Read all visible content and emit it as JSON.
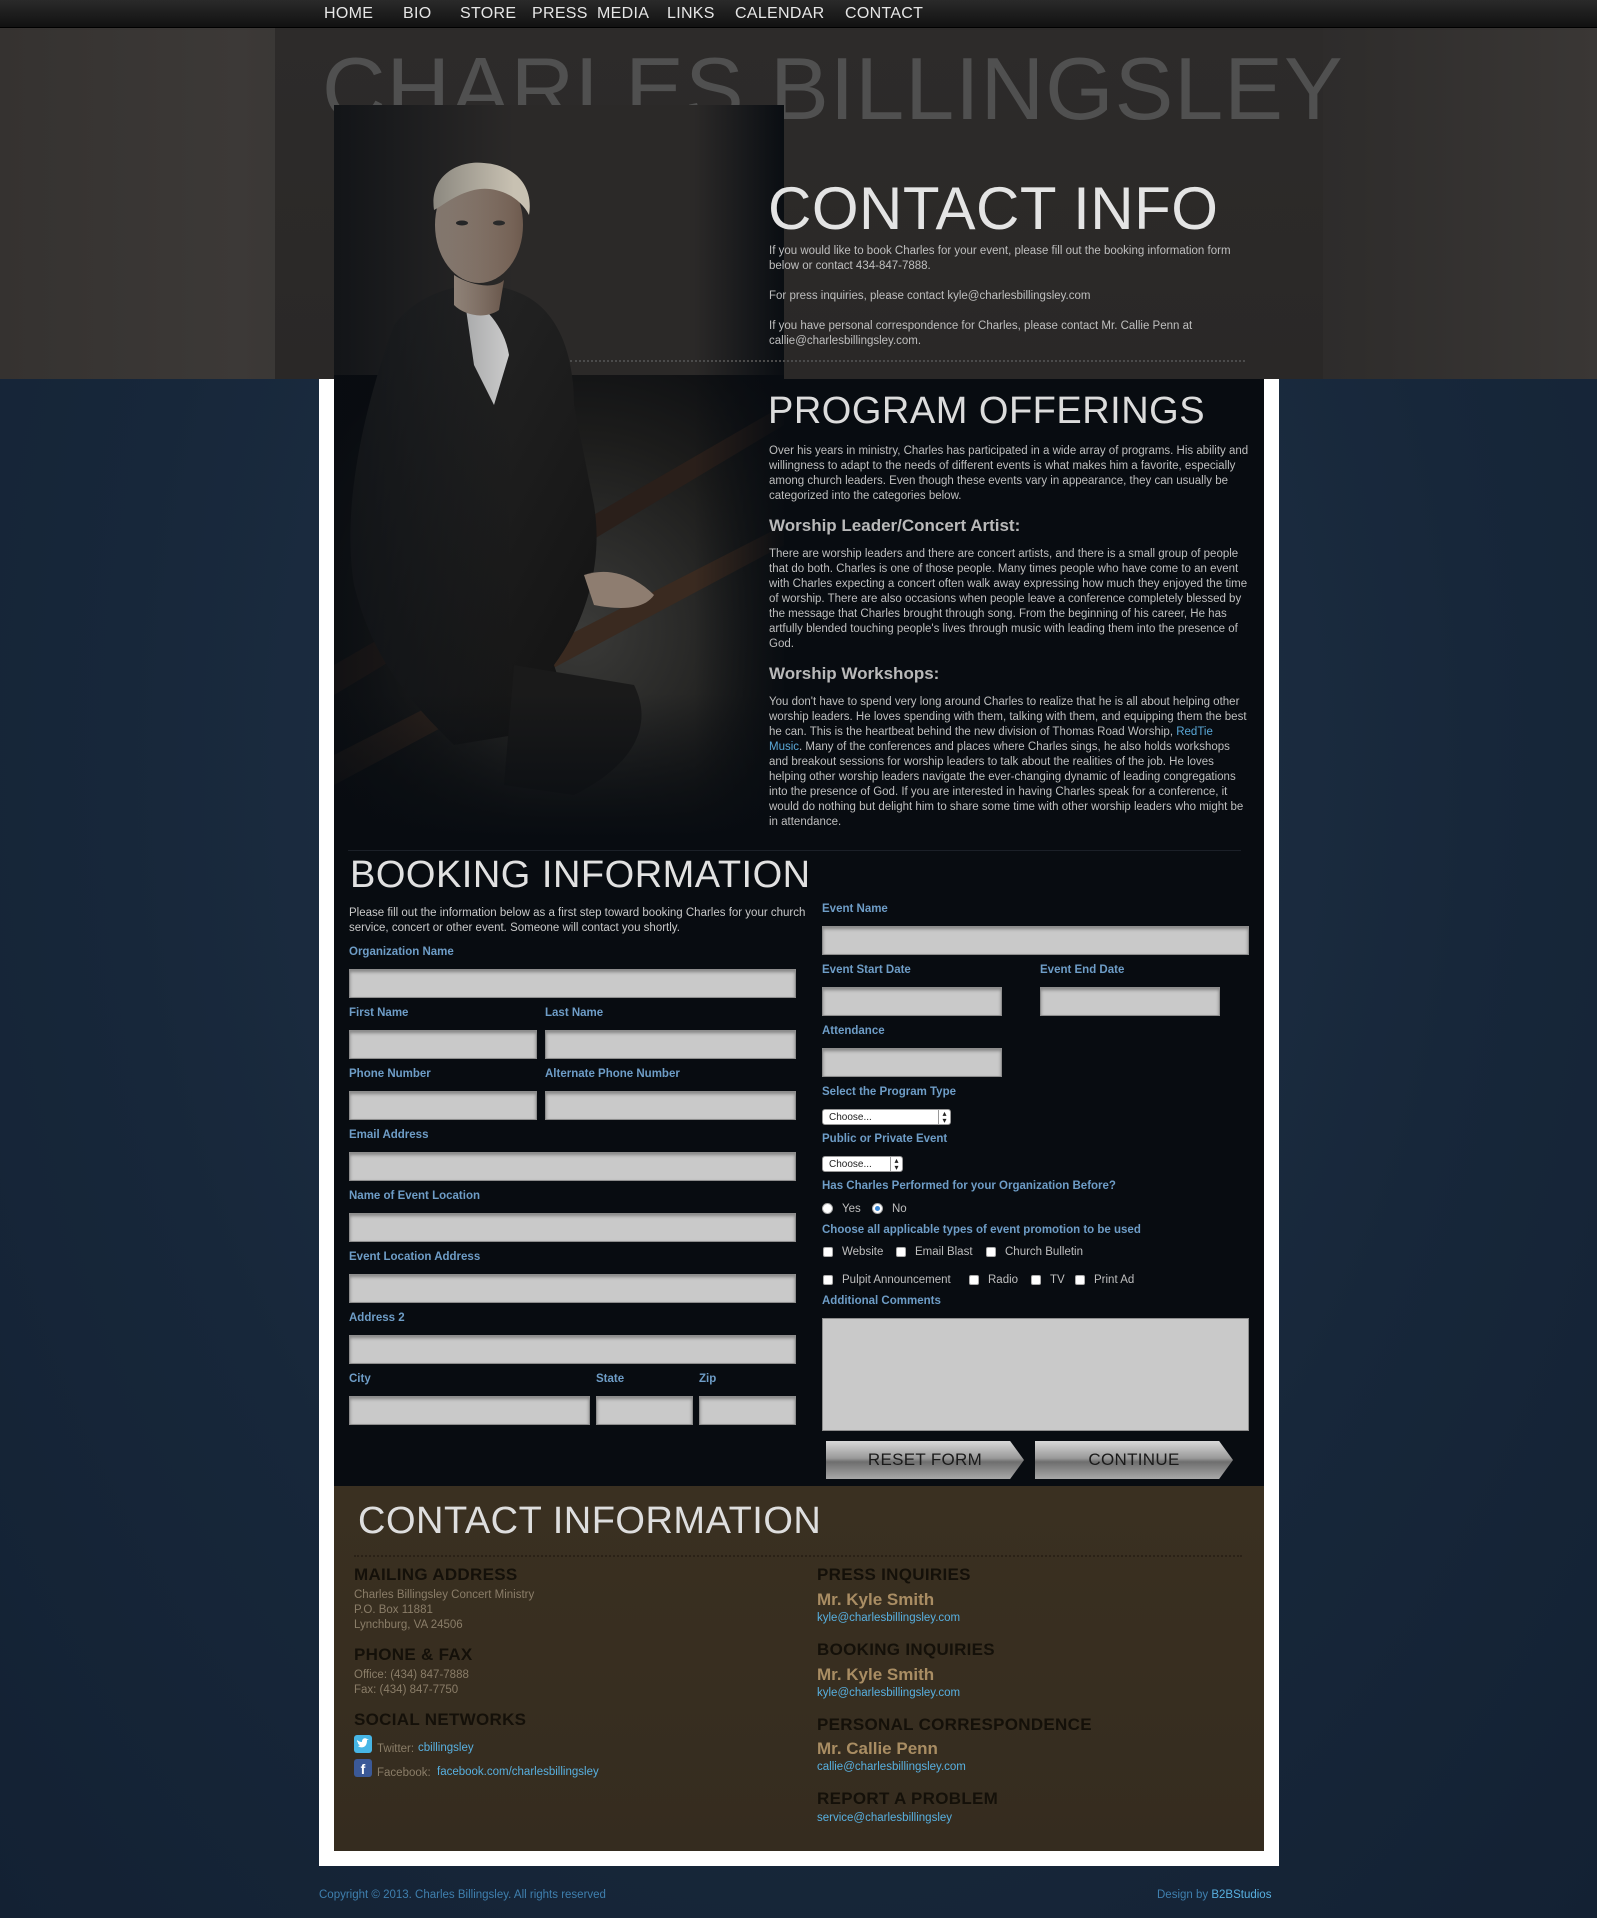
{
  "nav": {
    "items": [
      "HOME",
      "BIO",
      "STORE",
      "PRESS",
      "MEDIA",
      "LINKS",
      "CALENDAR",
      "CONTACT"
    ]
  },
  "header": {
    "site_title": "CHARLES BILLINGSLEY"
  },
  "contact_info": {
    "title": "CONTACT INFO",
    "p1": "If you would like to book Charles for your event, please fill out the booking information form below or contact 434-847-7888.",
    "p2": "For press inquiries, please contact kyle@charlesbillingsley.com",
    "p3": "If you have personal correspondence for Charles, please contact Mr. Callie Penn at callie@charlesbillingsley.com."
  },
  "program": {
    "title": "PROGRAM OFFERINGS",
    "intro": "Over his years in ministry, Charles has participated in a wide array of programs. His ability and willingness to adapt to the needs of different events is what makes him a favorite, especially among church leaders. Even though these events vary in appearance, they can usually be categorized into the categories below.",
    "worship_leader_title": "Worship Leader/Concert Artist:",
    "worship_leader_text": "There are worship leaders and there are concert artists, and there is a small group of people that do both.  Charles is one of those people. Many times people who have come to an event with Charles expecting a concert often walk away expressing how much they enjoyed the time of worship. There are also occasions when people leave a conference completely blessed by the message that Charles brought through song. From the beginning of his career, He has artfully blended touching people's lives through music with leading them into the presence of God.",
    "workshops_title": "Worship Workshops:",
    "workshops_text_a": "You don't have to spend very long around Charles to realize that he is all about helping other worship leaders. He loves spending with them, talking with them, and equipping them the best he can. This is the heartbeat behind the new division of Thomas Road Worship, ",
    "workshops_link": "RedTie Music",
    "workshops_text_b": ". Many of the conferences and places where Charles sings, he also holds workshops and breakout sessions for worship leaders to talk about the realities of the job. He loves helping other worship leaders navigate the ever-changing dynamic of leading congregations into the presence of God. If you are interested in having Charles speak for a conference, it would do nothing but delight him to share some time with other worship leaders who might be in attendance."
  },
  "booking": {
    "title": "BOOKING INFORMATION",
    "intro": "Please fill out the information below as a first step toward booking Charles for your church service, concert or other event. Someone will contact you shortly.",
    "labels": {
      "org": "Organization Name",
      "first": "First Name",
      "last": "Last Name",
      "phone": "Phone Number",
      "alt_phone": "Alternate Phone Number",
      "email": "Email Address",
      "location_name": "Name of Event Location",
      "location_address": "Event Location Address",
      "address2": "Address 2",
      "city": "City",
      "state": "State",
      "zip": "Zip",
      "event_name": "Event Name",
      "start_date": "Event Start Date",
      "end_date": "Event End Date",
      "attendance": "Attendance",
      "program_type": "Select the Program Type",
      "public_private": "Public or Private Event",
      "performed_before": "Has Charles Performed for your Organization Before?",
      "promotion": "Choose all applicable types of event promotion to be used",
      "comments": "Additional Comments"
    },
    "program_type_value": "Choose...",
    "public_private_value": "Choose...",
    "radio_yes": "Yes",
    "radio_no": "No",
    "checkboxes": [
      "Website",
      "Email Blast",
      "Church Bulletin",
      "Pulpit Announcement",
      "Radio",
      "TV",
      "Print Ad"
    ],
    "reset_label": "RESET FORM",
    "continue_label": "CONTINUE"
  },
  "contact_section": {
    "title": "CONTACT INFORMATION",
    "mailing_title": "MAILING ADDRESS",
    "mailing_lines": [
      "Charles Billingsley Concert Ministry",
      "P.O. Box 11881",
      "Lynchburg, VA 24506"
    ],
    "phone_title": "PHONE & FAX",
    "phone_lines": [
      "Office: (434) 847-7888",
      "Fax: (434) 847-7750"
    ],
    "social_title": "SOCIAL NETWORKS",
    "twitter_label": "Twitter: ",
    "twitter_handle": "cbillingsley",
    "facebook_label": "Facebook: ",
    "facebook_link": "facebook.com/charlesbillingsley",
    "press_title": "PRESS INQUIRIES",
    "press_name": "Mr. Kyle Smith",
    "press_email": "kyle@charlesbillingsley.com",
    "booking_title": "BOOKING INQUIRIES",
    "booking_name": "Mr. Kyle Smith",
    "booking_email": "kyle@charlesbillingsley.com",
    "personal_title": "PERSONAL CORRESPONDENCE",
    "personal_name": "Mr. Callie Penn",
    "personal_email": "callie@charlesbillingsley.com",
    "problem_title": "REPORT A PROBLEM",
    "problem_email": "service@charlesbillingsley"
  },
  "footer": {
    "copyright": "Copyright © 2013. Charles Billingsley. All rights reserved",
    "design_prefix": "Design by ",
    "design_link": "B2BStudios"
  }
}
